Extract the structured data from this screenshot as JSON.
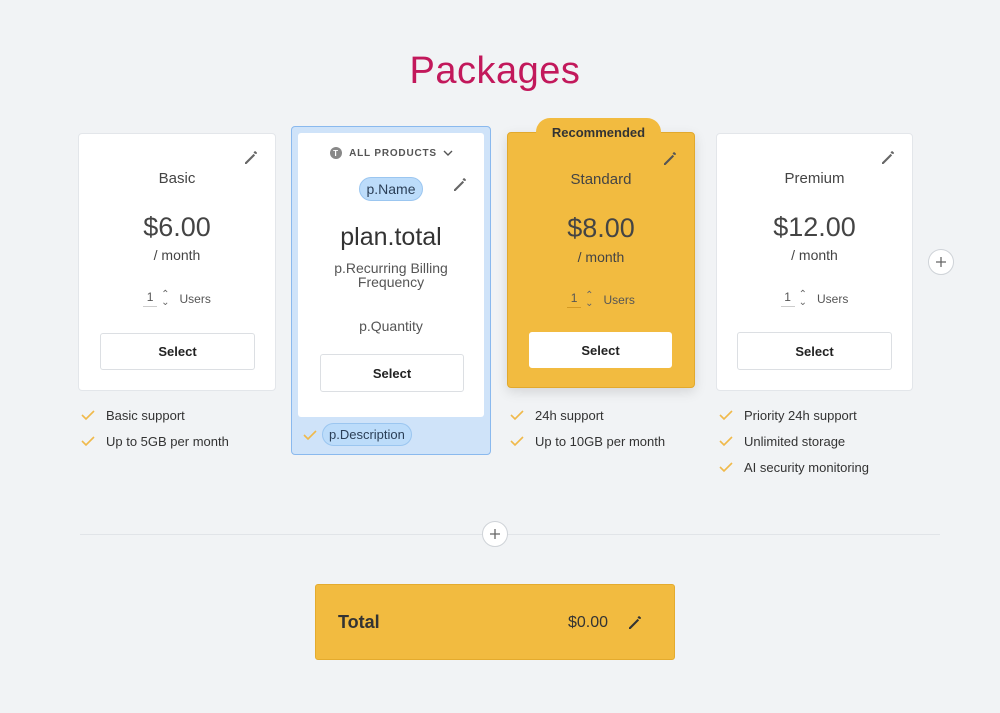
{
  "page": {
    "title": "Packages"
  },
  "plans": [
    {
      "name": "Basic",
      "price": "$6.00",
      "period": "/ month",
      "quantity": "1",
      "quantity_label": "Users",
      "select_label": "Select",
      "features": [
        "Basic support",
        "Up to 5GB per month"
      ]
    },
    {
      "product_selector": "ALL PRODUCTS",
      "name": "p.Name",
      "price": "plan.total",
      "period": "p.Recurring Billing Frequency",
      "quantity": "p.Quantity",
      "select_label": "Select",
      "features": [
        "p.Description"
      ]
    },
    {
      "badge": "Recommended",
      "name": "Standard",
      "price": "$8.00",
      "period": "/ month",
      "quantity": "1",
      "quantity_label": "Users",
      "select_label": "Select",
      "features": [
        "24h support",
        "Up to 10GB per month"
      ]
    },
    {
      "name": "Premium",
      "price": "$12.00",
      "period": "/ month",
      "quantity": "1",
      "quantity_label": "Users",
      "select_label": "Select",
      "features": [
        "Priority 24h support",
        "Unlimited storage",
        "AI security monitoring"
      ]
    }
  ],
  "total": {
    "label": "Total",
    "value": "$0.00"
  },
  "colors": {
    "accent_title": "#c2185b",
    "highlight": "#f2bb40",
    "selected_blue": "#cfe3f9",
    "check": "#f0b94a"
  }
}
